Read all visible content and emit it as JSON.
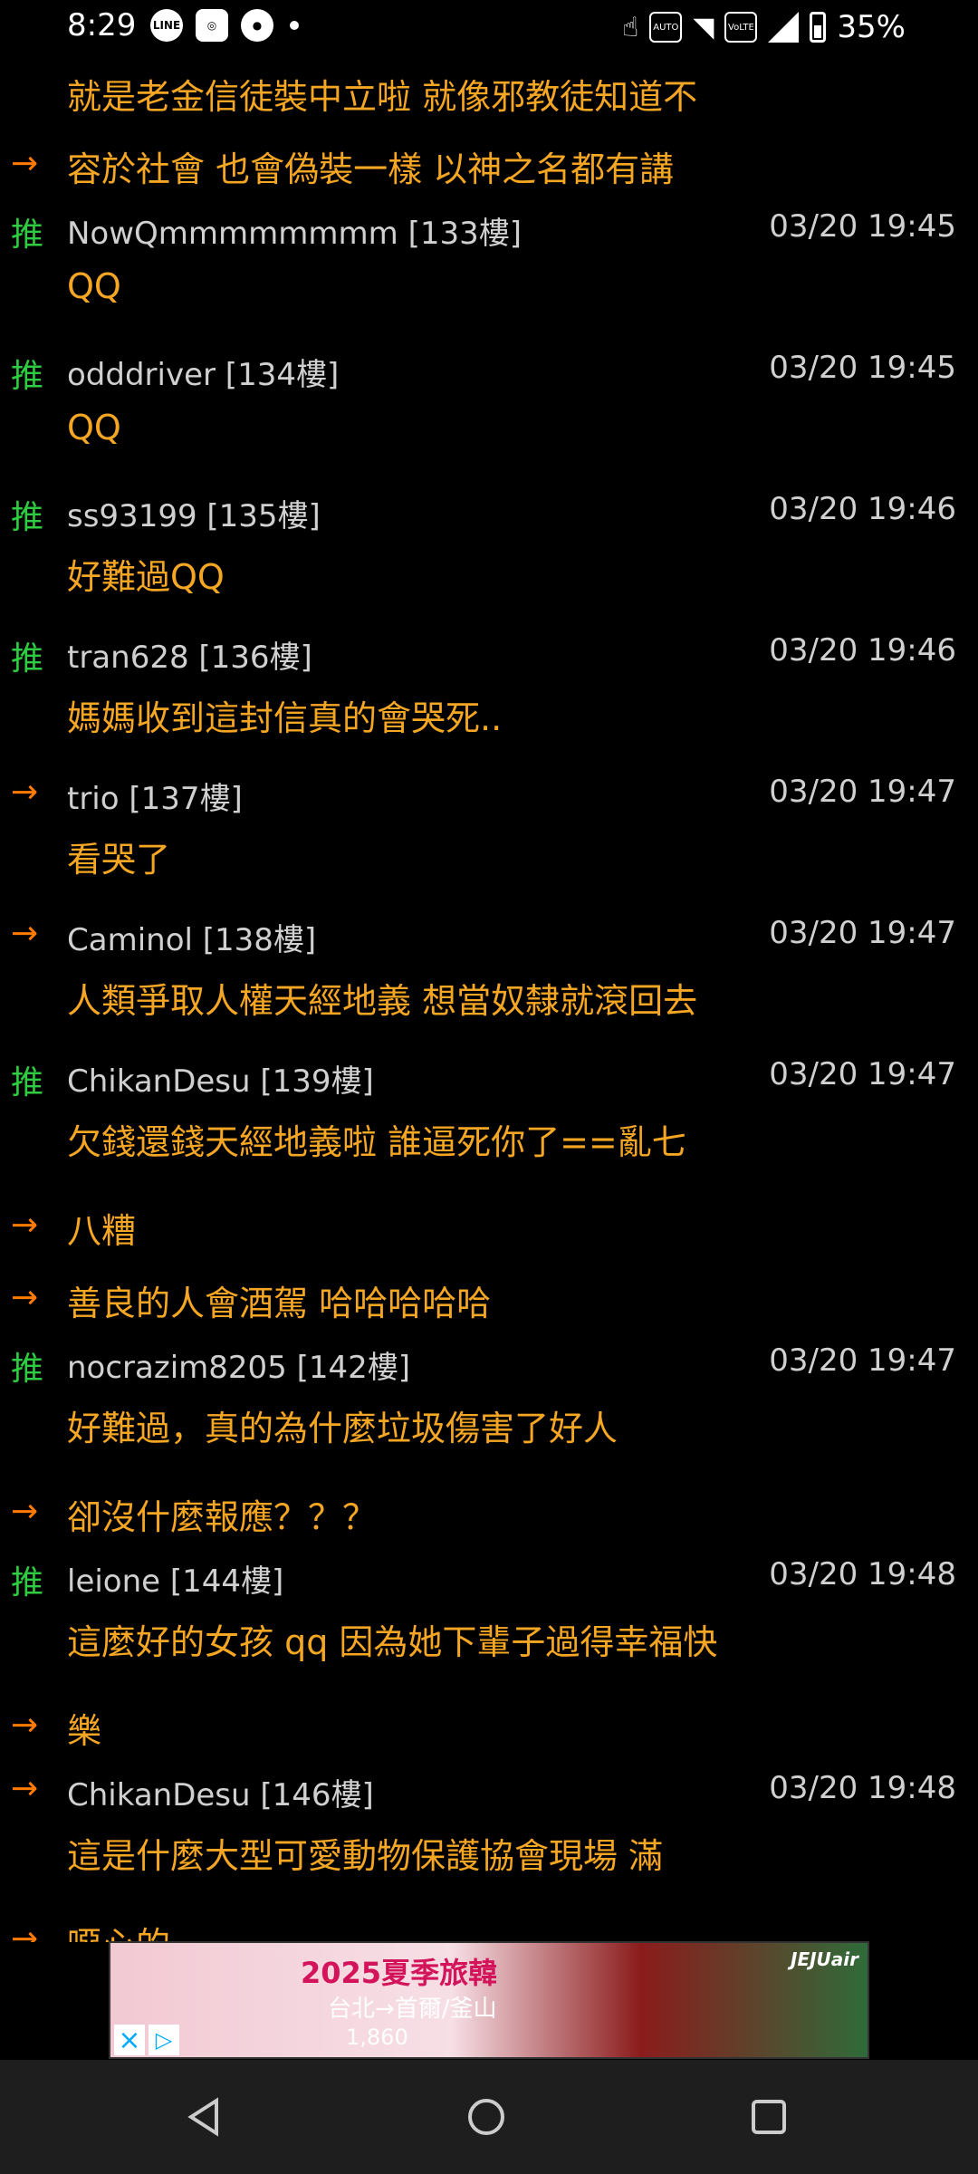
{
  "status_bar": {
    "time": "8:29",
    "battery": "35%",
    "left_icons": [
      "line-icon",
      "zhangbao-icon",
      "reddit-icon",
      "dot-icon"
    ],
    "right_icons": [
      "touch-icon",
      "auto-hz-icon",
      "wifi-6-icon",
      "volte-icon",
      "signal-icon",
      "battery-icon"
    ]
  },
  "comments": [
    {
      "type": "cont",
      "tag": "",
      "text": "就是老金信徒裝中立啦  就像邪教徒知道不"
    },
    {
      "type": "cont",
      "tag": "→",
      "text": "容於社會  也會偽裝一樣  以神之名都有講"
    },
    {
      "type": "head",
      "tag": "推",
      "author": "NowQmmmmmmmm  [133樓]",
      "time": "03/20 19:45"
    },
    {
      "type": "body",
      "text": "QQ"
    },
    {
      "type": "head",
      "tag": "推",
      "author": "odddriver  [134樓]",
      "time": "03/20 19:45"
    },
    {
      "type": "body",
      "text": "QQ"
    },
    {
      "type": "head",
      "tag": "推",
      "author": "ss93199  [135樓]",
      "time": "03/20 19:46"
    },
    {
      "type": "body",
      "text": "好難過QQ"
    },
    {
      "type": "head",
      "tag": "推",
      "author": "tran628  [136樓]",
      "time": "03/20 19:46"
    },
    {
      "type": "body",
      "text": "媽媽收到這封信真的會哭死.."
    },
    {
      "type": "head",
      "tag": "→",
      "author": "trio  [137樓]",
      "time": "03/20 19:47"
    },
    {
      "type": "body",
      "text": "看哭了"
    },
    {
      "type": "head",
      "tag": "→",
      "author": "Caminol  [138樓]",
      "time": "03/20 19:47"
    },
    {
      "type": "body",
      "text": "人類爭取人權天經地義  想當奴隸就滾回去"
    },
    {
      "type": "head",
      "tag": "推",
      "author": "ChikanDesu  [139樓]",
      "time": "03/20 19:47"
    },
    {
      "type": "body",
      "text": "欠錢還錢天經地義啦  誰逼死你了==亂七"
    },
    {
      "type": "cont",
      "tag": "→",
      "text": "八糟"
    },
    {
      "type": "cont",
      "tag": "→",
      "text": "善良的人會酒駕  哈哈哈哈哈"
    },
    {
      "type": "head",
      "tag": "推",
      "author": "nocrazim8205  [142樓]",
      "time": "03/20 19:47"
    },
    {
      "type": "body",
      "text": "好難過，真的為什麼垃圾傷害了好人"
    },
    {
      "type": "cont",
      "tag": "→",
      "text": "卻沒什麼報應？？？"
    },
    {
      "type": "head",
      "tag": "推",
      "author": "leione  [144樓]",
      "time": "03/20 19:48"
    },
    {
      "type": "body",
      "text": "這麼好的女孩  qq  因為她下輩子過得幸福快"
    },
    {
      "type": "cont",
      "tag": "→",
      "text": "樂"
    },
    {
      "type": "head",
      "tag": "→",
      "author": "ChikanDesu  [146樓]",
      "time": "03/20 19:48"
    },
    {
      "type": "body",
      "text": "這是什麼大型可愛動物保護協會現場  滿"
    },
    {
      "type": "cont",
      "tag": "→",
      "text": "噁心的"
    }
  ],
  "ad": {
    "title": "2025夏季旅韓",
    "route": "台北→首爾/釜山",
    "price": "1,860",
    "brand": "JEJUair",
    "close_icon": "close-icon",
    "play_icon": "adchoices-icon"
  },
  "navbar": {
    "back_icon": "back-icon",
    "home_icon": "home-icon",
    "recents_icon": "recents-icon"
  }
}
